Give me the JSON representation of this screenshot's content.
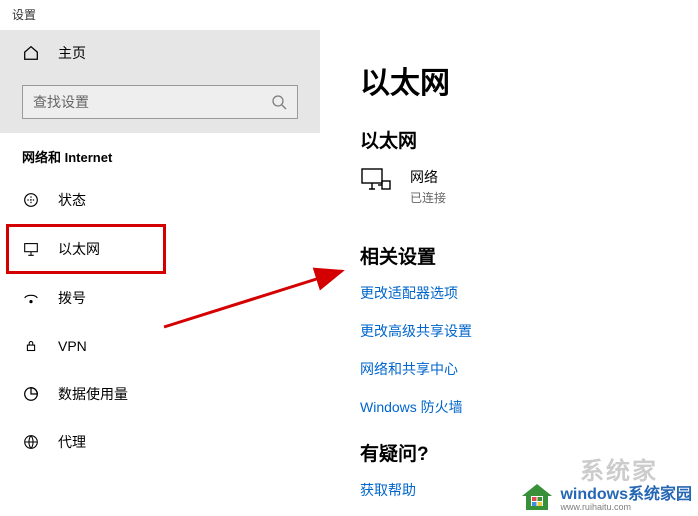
{
  "window_title": "设置",
  "sidebar": {
    "home_label": "主页",
    "search_placeholder": "查找设置",
    "category": "网络和 Internet",
    "items": [
      {
        "label": "状态"
      },
      {
        "label": "以太网"
      },
      {
        "label": "拨号"
      },
      {
        "label": "VPN"
      },
      {
        "label": "数据使用量"
      },
      {
        "label": "代理"
      }
    ]
  },
  "main": {
    "page_title": "以太网",
    "section1": {
      "title": "以太网",
      "status_name": "网络",
      "status_desc": "已连接"
    },
    "section2": {
      "title": "相关设置",
      "links": [
        "更改适配器选项",
        "更改高级共享设置",
        "网络和共享中心",
        "Windows 防火墙"
      ]
    },
    "section3": {
      "title": "有疑问?",
      "help_link": "获取帮助"
    }
  },
  "watermark": {
    "brand": "windows系统家园",
    "url": "www.ruihaitu.com"
  },
  "pale_bg_text": "系统家"
}
